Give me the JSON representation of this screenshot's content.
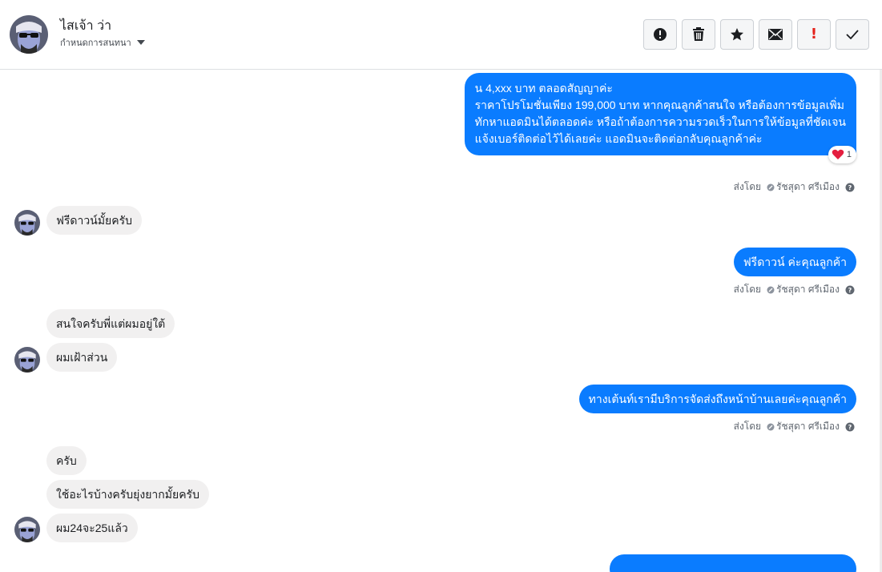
{
  "header": {
    "contact_name": "ไสเจ้า ว่า",
    "subtitle": "กำหนดการสนทนา",
    "toolbar": [
      {
        "icon": "alert-circle-icon",
        "name": "mark-spam-button"
      },
      {
        "icon": "trash-icon",
        "name": "delete-button"
      },
      {
        "icon": "star-icon",
        "name": "star-button"
      },
      {
        "icon": "envelope-icon",
        "name": "mark-unread-button"
      },
      {
        "icon": "exclamation-icon",
        "name": "priority-button",
        "glyph": "!"
      },
      {
        "icon": "check-icon",
        "name": "done-button"
      }
    ]
  },
  "thread": {
    "message_1": {
      "lines": [
        "น 4,xxx บาท ตลอดสัญญาค่ะ",
        "ราคาโปรโมชั่นเพียง 199,000 บาท หากคุณลูกค้าสนใจ หรือต้องการข้อมูลเพิ่ม",
        "ทักหาแอดมินได้ตลอดค่ะ หรือถ้าต้องการความรวดเร็วในการให้ข้อมูลที่ชัดเจน",
        "แจ้งเบอร์ติดต่อไว้ได้เลยค่ะ แอดมินจะติดต่อกลับคุณลูกค้าค่ะ"
      ],
      "reaction_count": "1"
    },
    "sent_by_label": "ส่งโดย",
    "agent_name": "รัชสุดา ศรีเมือง",
    "message_2": "ฟรีดาวน์มั้ยครับ",
    "message_3": "ฟรีดาวน์ ค่ะคุณลูกค้า",
    "message_4": "สนใจครับพี่แต่ผมอยู่ใต้",
    "message_5": "ผมเฝ้าส่วน",
    "message_6": "ทางเต้นท์เรามีบริการจัดส่งถึงหน้าบ้านเลยค่ะคุณลูกค้า",
    "message_7": "ครับ",
    "message_8": "ใช้อะไรบ้างครับยุ่งยากมั้ยครับ",
    "message_9": "ผม24จะ25แล้ว"
  },
  "colors": {
    "outgoing_bubble": "#0a7cff",
    "incoming_bubble": "#f1f0f0",
    "accent_red": "#e4221b"
  }
}
